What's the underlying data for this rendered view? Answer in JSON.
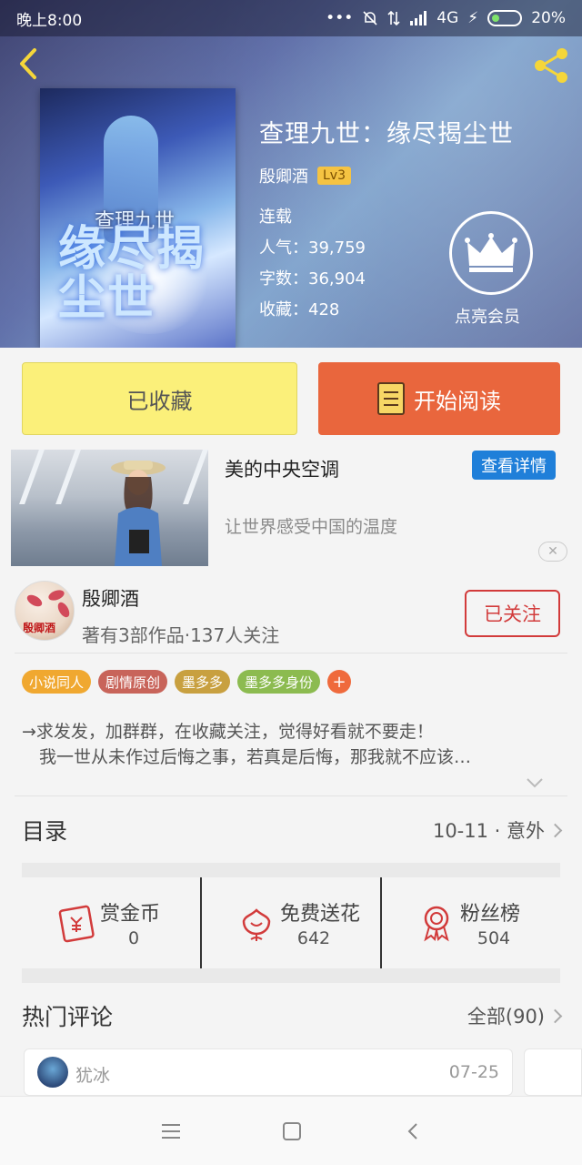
{
  "status_bar": {
    "time": "晚上8:00",
    "network": "4G",
    "battery": "20%"
  },
  "book": {
    "title": "查理九世：缘尽揭尘世",
    "author": "殷卿酒",
    "level": "Lv3",
    "status": "连载",
    "popularity": "人气：39,759",
    "word_count": "字数：36,904",
    "favorites": "收藏：428",
    "cover_text_small": "查理九世",
    "cover_text_big": "缘尽揭尘世"
  },
  "vip": {
    "label": "点亮会员"
  },
  "actions": {
    "favorite_label": "已收藏",
    "read_label": "开始阅读"
  },
  "ad": {
    "title": "美的中央空调",
    "button": "查看详情",
    "subtitle": "让世界感受中国的温度",
    "close": "✕"
  },
  "author_card": {
    "name": "殷卿酒",
    "meta": "著有3部作品·137人关注",
    "follow_label": "已关注",
    "avatar_text": "殷卿酒"
  },
  "tags": [
    {
      "label": "小说同人",
      "color": "#f0a830"
    },
    {
      "label": "剧情原创",
      "color": "#c8645a"
    },
    {
      "label": "墨多多",
      "color": "#c8a040"
    },
    {
      "label": "墨多多身份",
      "color": "#8cbb50"
    }
  ],
  "tag_add": "+",
  "description": {
    "line1": "→求发发，加群群，在收藏关注，觉得好看就不要走！",
    "line2": "　我一世从未作过后悔之事，若真是后悔，那我就不应该…"
  },
  "catalog": {
    "title": "目录",
    "latest": "10-11 · 意外"
  },
  "stats": [
    {
      "label": "赏金币",
      "value": "0",
      "icon": "red-envelope-icon"
    },
    {
      "label": "免费送花",
      "value": "642",
      "icon": "flower-icon"
    },
    {
      "label": "粉丝榜",
      "value": "504",
      "icon": "award-ribbon-icon"
    }
  ],
  "comments": {
    "title": "热门评论",
    "all_label": "全部(90)",
    "first_user": "犹冰",
    "first_date": "07-25"
  },
  "colors": {
    "accent_orange": "#e9663d",
    "favorite_yellow": "#fbf07a",
    "follow_red": "#d23b3b",
    "ad_blue": "#1f7fd9"
  }
}
